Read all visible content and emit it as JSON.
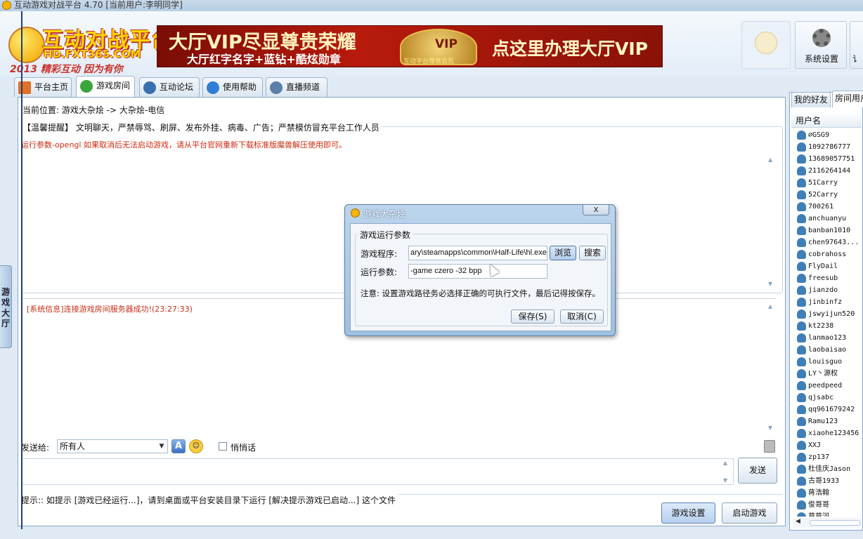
{
  "window": {
    "title": "互动游戏对战平台 4.70 [当前用户:李明同学]"
  },
  "header": {
    "logo_title": "互动对战平台",
    "logo_url": "HD.FXT365.COM",
    "logo_slogan": "2013 精彩互动 因为有你",
    "banner_line1": "大厅VIP尽显尊贵荣耀",
    "banner_line2": "大厅红字名字+蓝钻+酷炫勋章",
    "banner_emblem": "VIP",
    "banner_emblem_caption": "互动平台尊贵会员",
    "banner_right": "点这里办理大厅VIP",
    "system_settings": "系统设置",
    "next_partial": "讠"
  },
  "tabs": [
    {
      "label": "平台主页",
      "icon": "home-icon"
    },
    {
      "label": "游戏房间",
      "icon": "gamepad-icon"
    },
    {
      "label": "互动论坛",
      "icon": "users-icon"
    },
    {
      "label": "使用帮助",
      "icon": "help-icon"
    },
    {
      "label": "直播频道",
      "icon": "broadcast-icon"
    }
  ],
  "side_tab": "游戏大厅",
  "room": {
    "location": "当前位置: 游戏大杂烩 -> 大杂烩-电信",
    "notice": "【温馨提醒】 文明聊天，严禁辱骂、刷屏、发布外挂、病毒、广告；严禁模仿冒充平台工作人员",
    "run_params": "运行参数-opengl  如果取消后无法启动游戏，请从平台官网重新下载标准版魔兽解压使用即可。",
    "system_message": "[系统信息]连接游戏房间服务器成功!(23:27:33)",
    "send_to_label": "发送给:",
    "send_to_value": "所有人",
    "font_button": "A",
    "whisper_label": "悄悄话",
    "send_button": "发送",
    "tip": "提示:: 如提示 [游戏已经运行...]，请到桌面或平台安装目录下运行 [解决提示游戏已启动...] 这个文件",
    "game_settings_button": "游戏设置",
    "start_game_button": "启动游戏"
  },
  "right_panel": {
    "tab_friends": "我的好友",
    "tab_room_users": "房间用户",
    "column_header": "用户名",
    "users": [
      "∅GSG9",
      "1092786777",
      "13689057751",
      "2116264144",
      "51Carry",
      "52Carry",
      "700261",
      "anchuanyu",
      "banban1010",
      "chen97643...",
      "cobrahoss",
      "FlyDail",
      "freesub",
      "jianzdo",
      "jinbinfz",
      "jswyijun520",
      "kt2238",
      "lanmao123",
      "laobaisao",
      "louisguo",
      "LY丶源权",
      "peedpeed",
      "qjsabc",
      "qq961679242",
      "Ramu123",
      "xiaohe123456",
      "XXJ",
      "zp137",
      "杜佳庆Jason",
      "古哥1933",
      "蒋浩翰",
      "俊哥哥",
      "莫莫河"
    ]
  },
  "dialog": {
    "title": "游戏大杂烩",
    "close": "x",
    "group_label": "游戏运行参数",
    "program_label": "游戏程序:",
    "program_value": "ary\\steamapps\\common\\Half-Life\\hl.exe",
    "browse_button": "浏览",
    "search_button": "搜索",
    "params_label": "运行参数:",
    "params_value": "-game czero -32 bpp",
    "note": "注意: 设置游戏路径务必选择正确的可执行文件，最后记得按保存。",
    "save_button": "保存(S)",
    "cancel_button": "取消(C)"
  },
  "colors": {
    "accent": "#1f3f78",
    "warning_text": "#d02a10",
    "banner": "#b81a0c"
  }
}
